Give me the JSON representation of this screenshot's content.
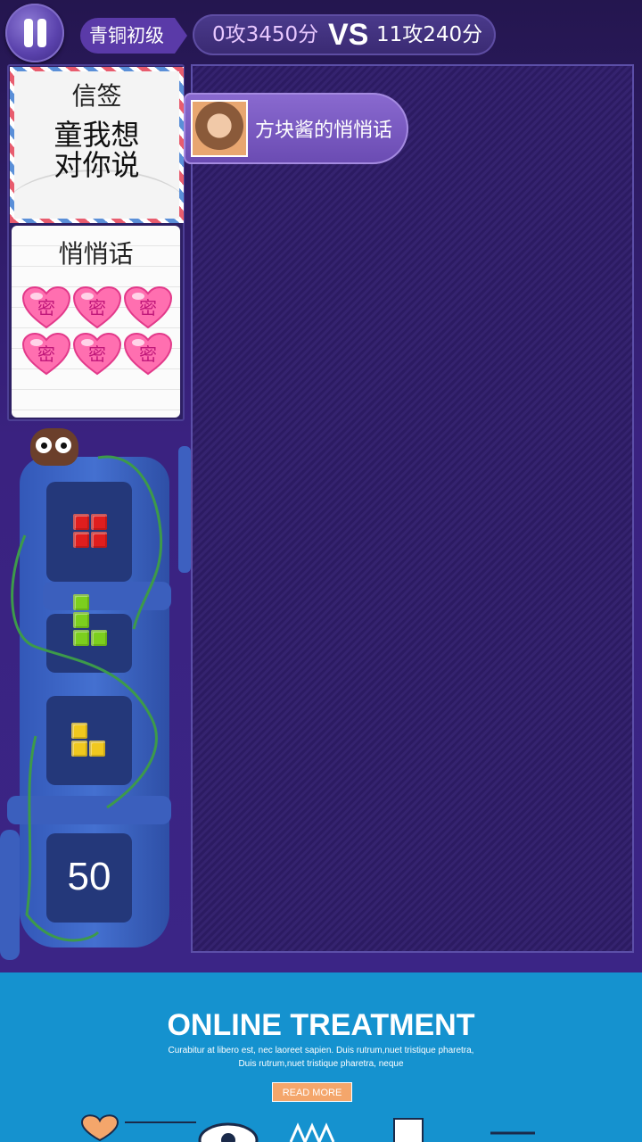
{
  "top_bar": {
    "rank": "青铜初级",
    "my_score": "0攻3450分",
    "vs": "VS",
    "opponent_score": "11攻240分"
  },
  "letter": {
    "title": "信签",
    "message": "童我想对你说"
  },
  "whisper": {
    "title": "悄悄话",
    "hearts": [
      "密",
      "密",
      "密",
      "密",
      "密",
      "密"
    ]
  },
  "bubble": {
    "text": "方块酱的悄悄话"
  },
  "next_pieces": {
    "count": "50",
    "colors": [
      "#e01e1e",
      "#7ccf1e",
      "#f0c81e"
    ]
  },
  "ad": {
    "headline": "ONLINE TREATMENT",
    "body_line1": "Curabitur at libero est, nec laoreet sapien. Duis rutrum,nuet tristique pharetra,",
    "body_line2": "Duis rutrum,nuet tristique pharetra, neque",
    "button": "READ MORE"
  }
}
